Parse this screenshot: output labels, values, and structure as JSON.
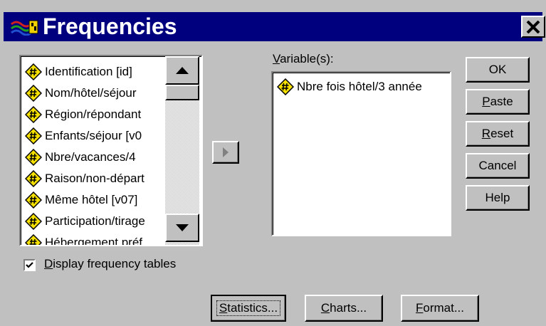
{
  "window": {
    "title": "Frequencies"
  },
  "source_list": {
    "items": [
      "Identification [id]",
      "Nom/hôtel/séjour",
      "Région/répondant",
      "Enfants/séjour [v0",
      "Nbre/vacances/4",
      "Raison/non-départ",
      "Même hôtel [v07]",
      "Participation/tirage",
      "Hébergement préf"
    ]
  },
  "variables": {
    "label_prefix": "V",
    "label_rest": "ariable(s):",
    "items": [
      "Nbre fois hôtel/3 année"
    ]
  },
  "buttons": {
    "ok": "OK",
    "paste_u": "P",
    "paste_rest": "aste",
    "reset_u": "R",
    "reset_rest": "eset",
    "cancel": "Cancel",
    "help": "Help",
    "statistics_u": "S",
    "statistics_rest": "tatistics...",
    "charts_u": "C",
    "charts_rest": "harts...",
    "format_u": "F",
    "format_rest": "ormat..."
  },
  "display_tables": {
    "checked": true,
    "label_u": "D",
    "label_rest": "isplay frequency tables"
  },
  "colors": {
    "titlebar": "#00007e",
    "face": "#c0c0c0",
    "icon_fill": "#f5e000"
  }
}
